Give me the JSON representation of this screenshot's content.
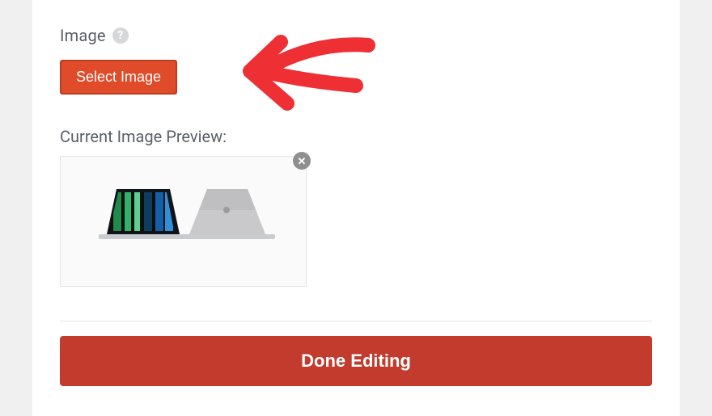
{
  "image_field": {
    "label": "Image",
    "help_tooltip": "?",
    "select_button": "Select Image"
  },
  "preview": {
    "label": "Current Image Preview:",
    "remove_icon": "✕",
    "alt": "Two laptops product image"
  },
  "footer": {
    "done_button": "Done Editing"
  }
}
